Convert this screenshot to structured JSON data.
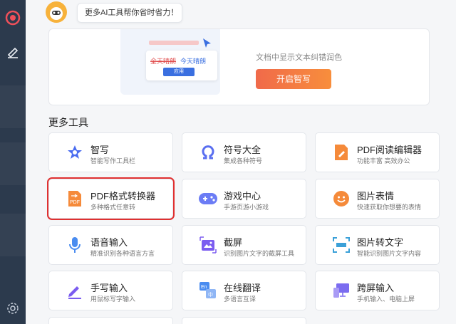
{
  "topbar": {
    "bubble_text": "更多AI工具帮你省时省力！"
  },
  "promo": {
    "image_text_strike": "全天晴朗",
    "image_text_new": "今天晴朗",
    "image_button": "应用",
    "description": "文档中显示文本纠错润色",
    "button_label": "开启智写"
  },
  "section_title": "更多工具",
  "tools": [
    {
      "title": "智写",
      "desc": "智能写作工具栏",
      "icon": "pen-star-icon"
    },
    {
      "title": "符号大全",
      "desc": "集成各种符号",
      "icon": "omega-icon"
    },
    {
      "title": "PDF阅读编辑器",
      "desc": "功能丰富 高效办公",
      "icon": "pdf-edit-icon"
    },
    {
      "title": "PDF格式转换器",
      "desc": "多种格式任意转",
      "icon": "pdf-convert-icon"
    },
    {
      "title": "游戏中心",
      "desc": "手游页游小游戏",
      "icon": "gamepad-icon"
    },
    {
      "title": "图片表情",
      "desc": "快速获取你想要的表情",
      "icon": "smiley-icon"
    },
    {
      "title": "语音输入",
      "desc": "精准识别各种语言方言",
      "icon": "microphone-icon"
    },
    {
      "title": "截屏",
      "desc": "识别图片文字的截屏工具",
      "icon": "screenshot-icon"
    },
    {
      "title": "图片转文字",
      "desc": "智能识别图片文字内容",
      "icon": "image-to-text-icon"
    },
    {
      "title": "手写输入",
      "desc": "用鼠标写字输入",
      "icon": "handwriting-pen-icon"
    },
    {
      "title": "在线翻译",
      "desc": "多语言互译",
      "icon": "translate-icon"
    },
    {
      "title": "跨屏输入",
      "desc": "手机输入、电脑上屏",
      "icon": "cross-screen-icon"
    }
  ],
  "colors": {
    "sidebar": "#2c3a4d",
    "accent": "#f06a4a",
    "highlight": "#e03030"
  }
}
